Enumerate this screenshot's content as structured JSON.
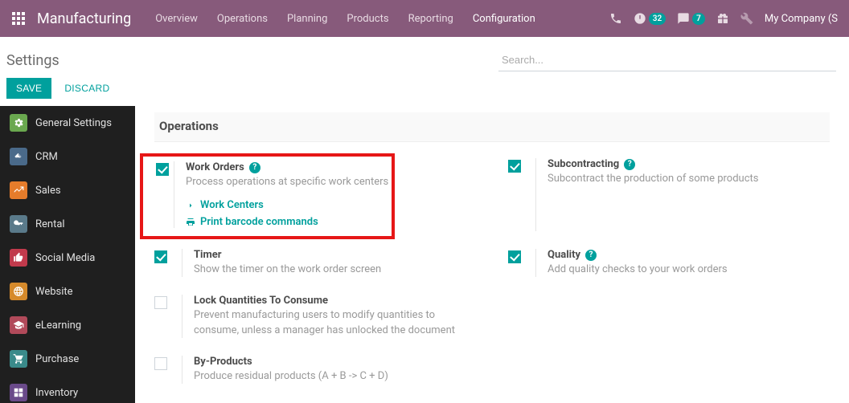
{
  "topbar": {
    "brand": "Manufacturing",
    "nav": [
      "Overview",
      "Operations",
      "Planning",
      "Products",
      "Reporting",
      "Configuration"
    ],
    "clock_badge": "32",
    "chat_badge": "7",
    "company": "My Company (S"
  },
  "controlbar": {
    "breadcrumb": "Settings",
    "search_placeholder": "Search..."
  },
  "buttons": {
    "save": "SAVE",
    "discard": "DISCARD"
  },
  "sidebar": {
    "items": [
      {
        "label": "General Settings",
        "color": "#6aa84f"
      },
      {
        "label": "CRM",
        "color": "#4a6a8a"
      },
      {
        "label": "Sales",
        "color": "#e57c2b"
      },
      {
        "label": "Rental",
        "color": "#5a7a8a"
      },
      {
        "label": "Social Media",
        "color": "#c13a4c"
      },
      {
        "label": "Website",
        "color": "#d68a2b"
      },
      {
        "label": "eLearning",
        "color": "#b14a5a"
      },
      {
        "label": "Purchase",
        "color": "#3a8a8a"
      },
      {
        "label": "Inventory",
        "color": "#6a4a8a"
      }
    ]
  },
  "section_title": "Operations",
  "settings": {
    "work_orders": {
      "title": "Work Orders",
      "desc": "Process operations at specific work centers",
      "checked": true,
      "link1": "Work Centers",
      "link2": "Print barcode commands"
    },
    "subcontracting": {
      "title": "Subcontracting",
      "desc": "Subcontract the production of some products",
      "checked": true
    },
    "timer": {
      "title": "Timer",
      "desc": "Show the timer on the work order screen",
      "checked": true
    },
    "quality": {
      "title": "Quality",
      "desc": "Add quality checks to your work orders",
      "checked": true
    },
    "lock_qty": {
      "title": "Lock Quantities To Consume",
      "desc": "Prevent manufacturing users to modify quantities to consume, unless a manager has unlocked the document",
      "checked": false
    },
    "by_products": {
      "title": "By-Products",
      "desc": "Produce residual products (A + B -> C + D)",
      "checked": false
    }
  }
}
